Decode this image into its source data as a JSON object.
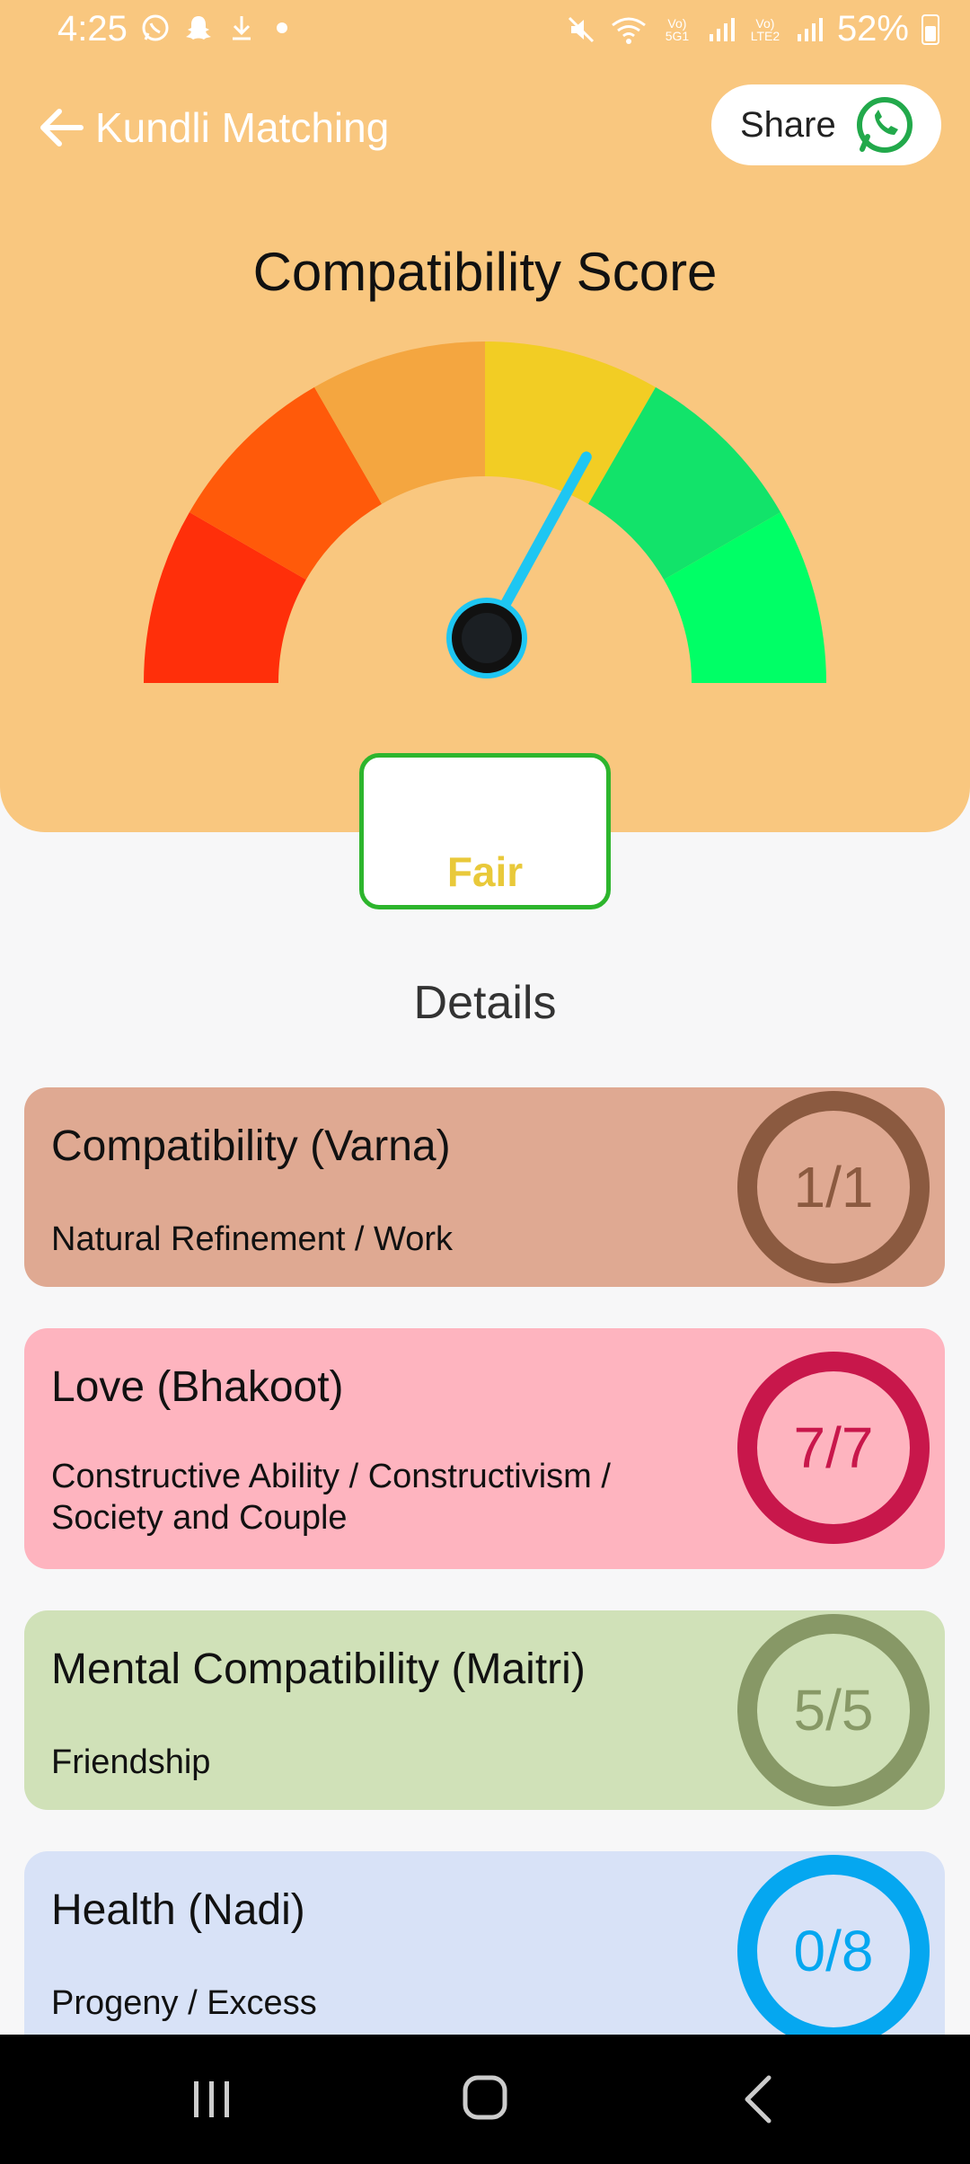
{
  "status_bar": {
    "time": "4:25",
    "battery": "52%",
    "sim1_label": "Vo) 5G1",
    "sim2_label": "Vo) LTE2",
    "icons": [
      "whatsapp-icon",
      "snapchat-icon",
      "download-icon",
      "dot-icon",
      "mute-icon",
      "wifi-icon",
      "signal-icon",
      "battery-icon"
    ]
  },
  "app_bar": {
    "title": "Kundli Matching",
    "share_label": "Share"
  },
  "score": {
    "title": "Compatibility Score",
    "rating": "Fair",
    "needle_fraction": 0.66,
    "gauge_colors": [
      "#ff2f0a",
      "#ff5a0a",
      "#f4a640",
      "#f2cd24",
      "#12e36a",
      "#00ff66"
    ],
    "rating_color": "#e9c93a",
    "border_color": "#2db52d"
  },
  "details": {
    "title": "Details",
    "items": [
      {
        "title": "Compatibility (Varna)",
        "subtitle": "Natural Refinement  / Work",
        "score": "1/1",
        "bg": "#dfa992",
        "ring": "#8b5a40",
        "text": "#8b5a40"
      },
      {
        "title": "Love (Bhakoot)",
        "subtitle": "Constructive Ability / Constructivism / Society and Couple",
        "score": "7/7",
        "bg": "#feb4bf",
        "ring": "#c8174b",
        "text": "#c8174b"
      },
      {
        "title": "Mental Compatibility (Maitri)",
        "subtitle": "Friendship",
        "score": "5/5",
        "bg": "#d0e1b8",
        "ring": "#879866",
        "text": "#879866"
      },
      {
        "title": "Health (Nadi)",
        "subtitle": "Progeny / Excess",
        "score": "0/8",
        "bg": "#d8e2f7",
        "ring": "#05a7f0",
        "text": "#05a7f0"
      }
    ]
  },
  "nav": [
    "recents-icon",
    "home-icon",
    "back-nav-icon"
  ]
}
